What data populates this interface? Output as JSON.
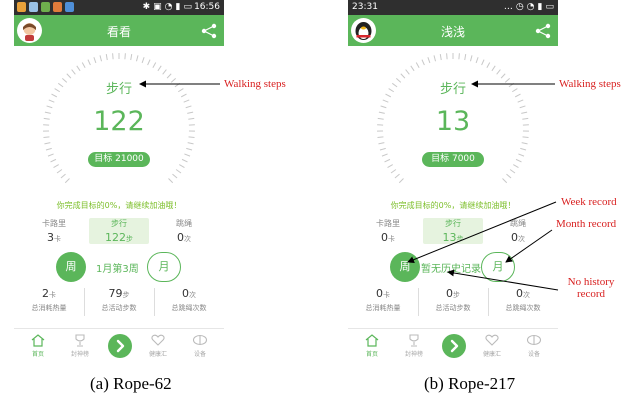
{
  "phones": {
    "a": {
      "time": "16:56",
      "title": "看看",
      "dial_label": "步行",
      "steps_value": "122",
      "goal": "目标 21000",
      "progress_message": "你完成目标的0%，请继续加油哦！",
      "stats_top": [
        {
          "label": "卡路里",
          "value": "3",
          "unit": "卡"
        },
        {
          "label": "步行",
          "value": "122",
          "unit": "步"
        },
        {
          "label": "跳绳",
          "value": "0",
          "unit": "次"
        }
      ],
      "week_button": "周",
      "record_label": "1月第3周",
      "month_button": "月",
      "stats_bottom": [
        {
          "value": "2",
          "unit": "卡",
          "label": "总消耗热量"
        },
        {
          "value": "79",
          "unit": "步",
          "label": "总活动步数"
        },
        {
          "value": "0",
          "unit": "次",
          "label": "总跳绳次数"
        }
      ],
      "tabs": [
        "首页",
        "封神榜",
        "",
        "健康汇",
        "设备"
      ]
    },
    "b": {
      "time": "23:31",
      "title": "浅浅",
      "dial_label": "步行",
      "steps_value": "13",
      "goal": "目标 7000",
      "progress_message": "你完成目标的0%，请继续加油哦！",
      "stats_top": [
        {
          "label": "卡路里",
          "value": "0",
          "unit": "卡"
        },
        {
          "label": "步行",
          "value": "13",
          "unit": "步"
        },
        {
          "label": "跳绳",
          "value": "0",
          "unit": "次"
        }
      ],
      "week_button": "周",
      "record_label": "暂无历史记录",
      "month_button": "月",
      "stats_bottom": [
        {
          "value": "0",
          "unit": "卡",
          "label": "总消耗热量"
        },
        {
          "value": "0",
          "unit": "步",
          "label": "总活动步数"
        },
        {
          "value": "0",
          "unit": "次",
          "label": "总跳绳次数"
        }
      ],
      "tabs": [
        "首页",
        "封神榜",
        "",
        "健康汇",
        "设备"
      ]
    }
  },
  "annotations": {
    "walking_steps_a": "Walking steps",
    "walking_steps_b": "Walking steps",
    "week_record": "Week record",
    "month_record": "Month record",
    "no_history_line1": "No history",
    "no_history_line2": "record"
  },
  "captions": {
    "a": "(a)  Rope-62",
    "b": "(b)  Rope-217"
  },
  "colors": {
    "app_green": "#5bb65a",
    "annotation_red": "#d81f1f",
    "status_bar": "#2f2f2f"
  },
  "icons": [
    "avatar",
    "share-icon",
    "home-icon",
    "trophy-icon",
    "play-icon",
    "heart-icon",
    "device-icon"
  ]
}
